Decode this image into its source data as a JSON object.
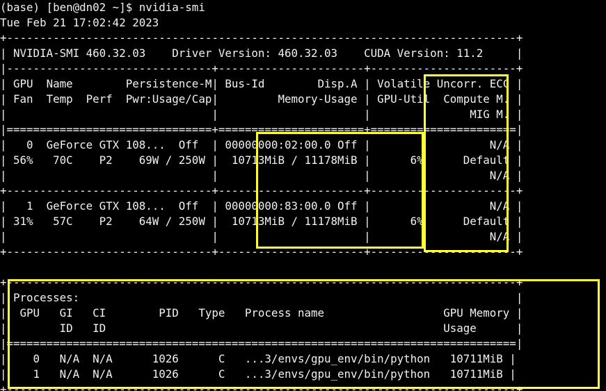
{
  "colors": {
    "background": "#000000",
    "text": "#f2f2f2",
    "highlight": "#ffff3a"
  },
  "terminal": {
    "lines": [
      "(base) [ben@dn02 ~]$ nvidia-smi",
      "Tue Feb 21 17:02:42 2023",
      "+-----------------------------------------------------------------------------+",
      "| NVIDIA-SMI 460.32.03    Driver Version: 460.32.03    CUDA Version: 11.2     |",
      "|-------------------------------+----------------------+----------------------+",
      "| GPU  Name        Persistence-M| Bus-Id        Disp.A | Volatile Uncorr. ECC |",
      "| Fan  Temp  Perf  Pwr:Usage/Cap|         Memory-Usage | GPU-Util  Compute M. |",
      "|                               |                      |               MIG M. |",
      "|===============================+======================+======================|",
      "|   0  GeForce GTX 108...  Off  | 00000000:02:00.0 Off |                  N/A |",
      "| 56%   70C    P2    69W / 250W |  10713MiB / 11178MiB |      6%      Default |",
      "|                               |                      |                  N/A |",
      "+-------------------------------+----------------------+----------------------+",
      "|   1  GeForce GTX 108...  Off  | 00000000:83:00.0 Off |                  N/A |",
      "| 31%   57C    P2    64W / 250W |  10713MiB / 11178MiB |      6%      Default |",
      "|                               |                      |                  N/A |",
      "+-------------------------------+----------------------+----------------------+",
      "",
      "+-----------------------------------------------------------------------------+",
      "| Processes:                                                                  |",
      "|  GPU   GI   CI        PID   Type   Process name                  GPU Memory |",
      "|        ID   ID                                                   Usage      |",
      "|=============================================================================|",
      "|    0   N/A  N/A      1026      C   ...3/envs/gpu_env/bin/python   10711MiB |",
      "|    1   N/A  N/A      1026      C   ...3/envs/gpu_env/bin/python   10711MiB |",
      "+-----------------------------------------------------------------------------+"
    ]
  }
}
